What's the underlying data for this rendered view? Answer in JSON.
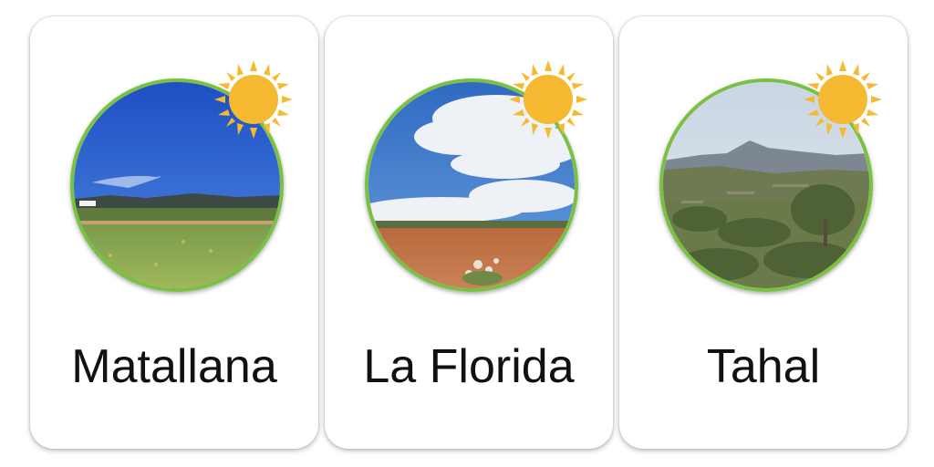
{
  "cards": [
    {
      "name": "Matallana",
      "weather_icon": "sun-icon",
      "photo": "grassland-blue-sky"
    },
    {
      "name": "La Florida",
      "weather_icon": "sun-icon",
      "photo": "red-soil-field-clouds"
    },
    {
      "name": "Tahal",
      "weather_icon": "sun-icon",
      "photo": "hills-olive-trees"
    }
  ],
  "colors": {
    "photo_ring": "#7ac143",
    "sun": "#f6b932"
  }
}
